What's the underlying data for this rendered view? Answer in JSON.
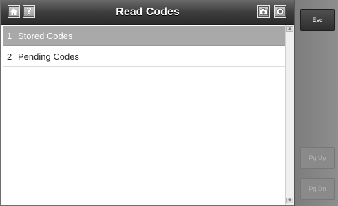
{
  "title": "Read Codes",
  "toolbar": {
    "home_icon": "home-icon",
    "help_label": "?",
    "camera_icon": "camera-icon",
    "record_icon": "record-icon"
  },
  "menu": {
    "items": [
      {
        "number": "1",
        "label": "Stored Codes",
        "selected": true
      },
      {
        "number": "2",
        "label": "Pending Codes",
        "selected": false
      }
    ]
  },
  "side_buttons": {
    "esc": "Esc",
    "pg_up": "Pg Up",
    "pg_dn": "Pg Dn"
  },
  "colors": {
    "selected_row": "#a9a9a9",
    "titlebar": "#3e3e3e",
    "side_panel": "#8a8a8a"
  }
}
